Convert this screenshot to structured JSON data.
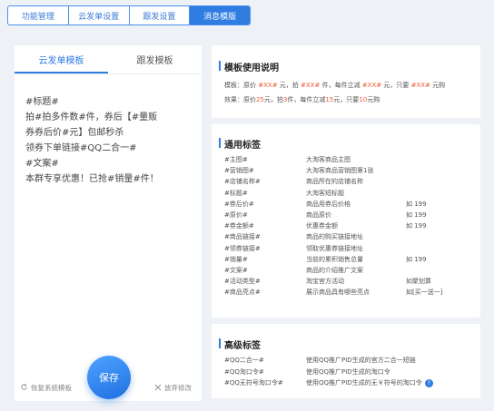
{
  "top_tabs": [
    {
      "label": "功能管理"
    },
    {
      "label": "云发单设置"
    },
    {
      "label": "跟发设置"
    },
    {
      "label": "消息模版"
    }
  ],
  "left": {
    "tabs": [
      {
        "label": "云发单模板"
      },
      {
        "label": "跟发模板"
      }
    ],
    "template_text": "#标题#\n拍#拍多件数#件，券后【#量贩\n券券后价#元】包邮秒杀\n领券下单链接#QQ二合一#\n#文案#\n本群专享优惠！已抢#销量#件！",
    "reset_label": "恢复系统模板",
    "discard_label": "放弃修改",
    "save_label": "保存"
  },
  "usage": {
    "title": "模板使用说明",
    "line1": {
      "a": "模板：原价 ",
      "b": "#XX#",
      "c": " 元，拍 ",
      "d": "#XX#",
      "e": " 件，每件立减 ",
      "f": "#XX#",
      "g": " 元，只要 ",
      "h": "#XX#",
      "i": " 元购"
    },
    "line2": {
      "a": "效果：原价",
      "b": "25",
      "c": "元，拍",
      "d": "3",
      "e": "件，每件立减",
      "f": "15",
      "g": "元，只要",
      "h": "10",
      "i": "元购"
    }
  },
  "common": {
    "title": "通用标签",
    "rows": [
      {
        "tag": "#主图#",
        "desc": "大淘客商品主图",
        "ex": ""
      },
      {
        "tag": "#营销图#",
        "desc": "大淘客商品营销图第1张",
        "ex": ""
      },
      {
        "tag": "#店铺名称#",
        "desc": "商品所在的店铺名称",
        "ex": ""
      },
      {
        "tag": "#标题#",
        "desc": "大淘客短标题",
        "ex": ""
      },
      {
        "tag": "#券后价#",
        "desc": "商品用券后价格",
        "ex": "如 199"
      },
      {
        "tag": "#原价#",
        "desc": "商品原价",
        "ex": "如 199"
      },
      {
        "tag": "#券金额#",
        "desc": "优惠券金额",
        "ex": "如 199"
      },
      {
        "tag": "#商品链接#",
        "desc": "商品的购买链接地址",
        "ex": ""
      },
      {
        "tag": "#领券链接#",
        "desc": "领取优惠券链接地址",
        "ex": ""
      },
      {
        "tag": "#销量#",
        "desc": "当前的累积销售总量",
        "ex": "如 199"
      },
      {
        "tag": "#文案#",
        "desc": "商品的介绍推广文案",
        "ex": ""
      },
      {
        "tag": "#活动类型#",
        "desc": "淘宝官方活动",
        "ex": "如聚划算"
      },
      {
        "tag": "#商品亮点#",
        "desc": "展示商品具有哪些亮点",
        "ex": "如[买一送一]"
      }
    ]
  },
  "advanced": {
    "title": "高级标签",
    "rows": [
      {
        "tag": "#QQ二合一#",
        "desc": "使用QQ推广PID生成的官方二合一短链"
      },
      {
        "tag": "#QQ淘口令#",
        "desc": "使用QQ推广PID生成的淘口令"
      },
      {
        "tag": "#QQ无符号淘口令#",
        "desc": "使用QQ推广PID生成的无￥符号的淘口令"
      }
    ]
  },
  "colors": {
    "accent": "#2f7de1",
    "highlight": "#f05a3a"
  }
}
